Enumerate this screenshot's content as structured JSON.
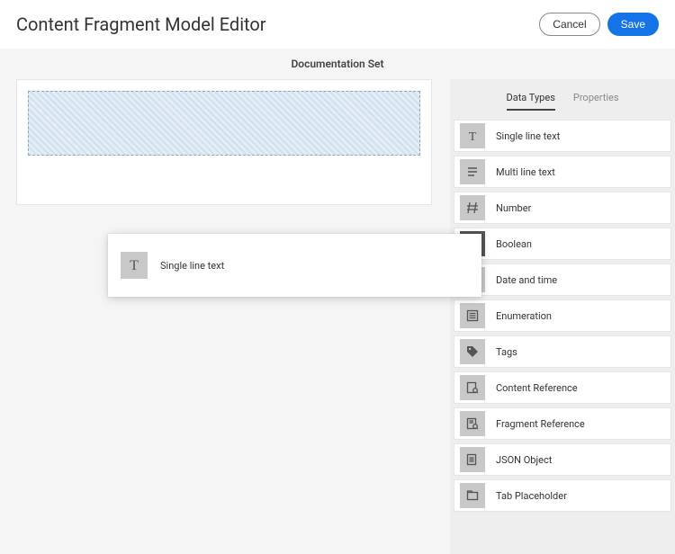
{
  "header": {
    "title": "Content Fragment Model Editor",
    "cancel_label": "Cancel",
    "save_label": "Save"
  },
  "subheader": "Documentation Set",
  "dragging": {
    "label": "Single line text"
  },
  "tabs": {
    "data_types": "Data Types",
    "properties": "Properties"
  },
  "types": [
    {
      "id": "single-line-text",
      "label": "Single line text",
      "icon": "text-icon"
    },
    {
      "id": "multi-line-text",
      "label": "Multi line text",
      "icon": "multiline-icon"
    },
    {
      "id": "number",
      "label": "Number",
      "icon": "number-icon"
    },
    {
      "id": "boolean",
      "label": "Boolean",
      "icon": "checkbox-icon",
      "dark": true
    },
    {
      "id": "date-and-time",
      "label": "Date and time",
      "icon": "calendar-icon"
    },
    {
      "id": "enumeration",
      "label": "Enumeration",
      "icon": "list-icon"
    },
    {
      "id": "tags",
      "label": "Tags",
      "icon": "tag-icon"
    },
    {
      "id": "content-reference",
      "label": "Content Reference",
      "icon": "content-ref-icon"
    },
    {
      "id": "fragment-reference",
      "label": "Fragment Reference",
      "icon": "fragment-ref-icon"
    },
    {
      "id": "json-object",
      "label": "JSON Object",
      "icon": "json-icon"
    },
    {
      "id": "tab-placeholder",
      "label": "Tab Placeholder",
      "icon": "tab-icon"
    }
  ]
}
